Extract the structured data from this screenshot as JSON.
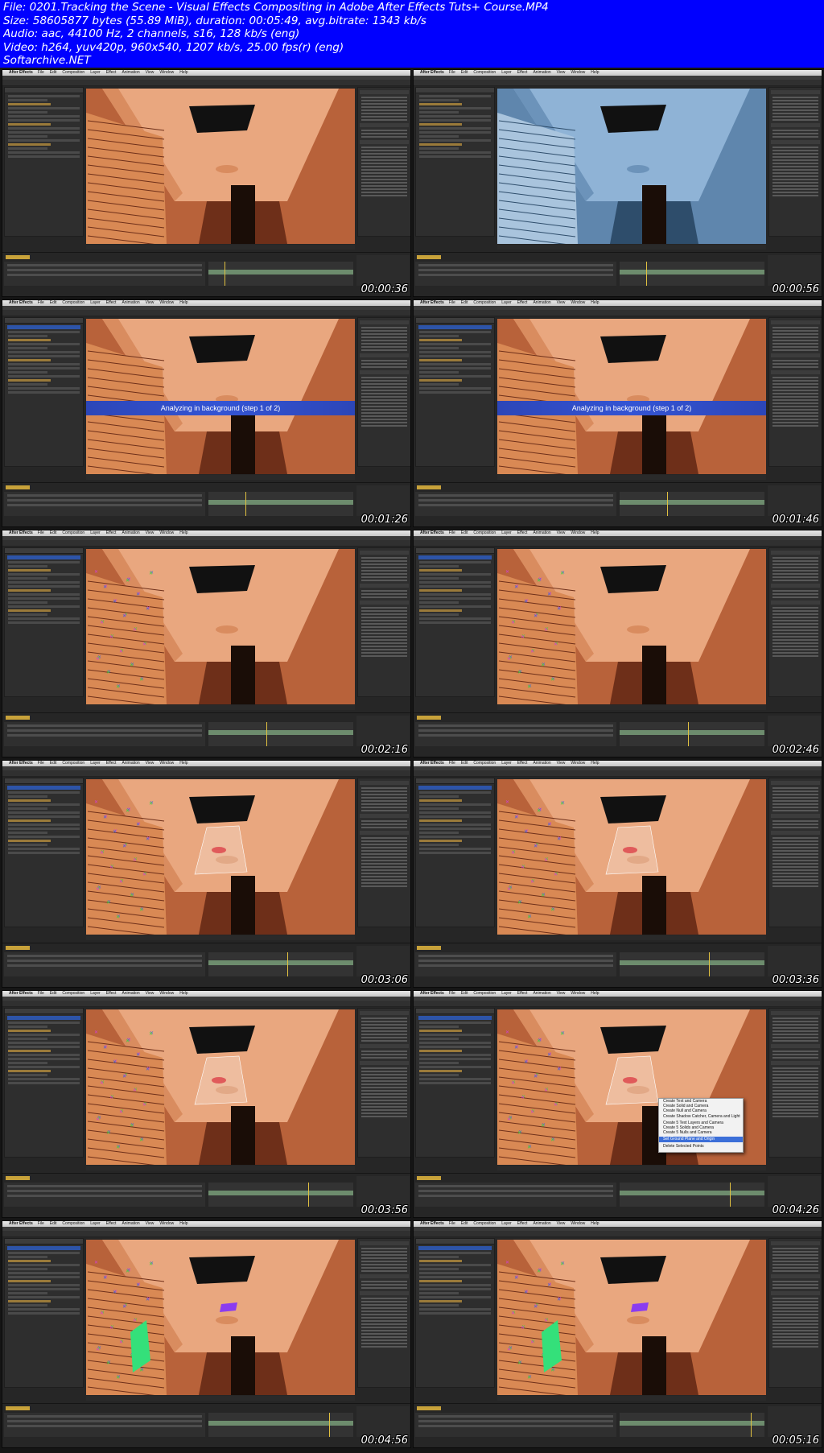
{
  "header": {
    "lines": [
      "File: 0201.Tracking the Scene - Visual Effects Compositing in Adobe After Effects Tuts+ Course.MP4",
      "Size: 58605877 bytes (55.89 MiB), duration: 00:05:49, avg.bitrate: 1343 kb/s",
      "Audio: aac, 44100 Hz, 2 channels, s16, 128 kb/s (eng)",
      "Video: h264, yuv420p, 960x540, 1207 kb/s, 25.00 fps(r) (eng)",
      "Softarchive.NET"
    ]
  },
  "menubar": {
    "app": "After Effects",
    "items": [
      "File",
      "Edit",
      "Composition",
      "Layer",
      "Effect",
      "Animation",
      "View",
      "Window",
      "Help"
    ]
  },
  "thumbnails": [
    {
      "time": "00:00:36",
      "variant": "orange"
    },
    {
      "time": "00:00:56",
      "variant": "blue"
    },
    {
      "time": "00:01:26",
      "variant": "banner"
    },
    {
      "time": "00:01:46",
      "variant": "banner"
    },
    {
      "time": "00:02:16",
      "variant": "track"
    },
    {
      "time": "00:02:46",
      "variant": "track"
    },
    {
      "time": "00:03:06",
      "variant": "target"
    },
    {
      "time": "00:03:36",
      "variant": "target"
    },
    {
      "time": "00:03:56",
      "variant": "target"
    },
    {
      "time": "00:04:26",
      "variant": "menu"
    },
    {
      "time": "00:04:56",
      "variant": "solids"
    },
    {
      "time": "00:05:16",
      "variant": "solids"
    }
  ],
  "banner_text": "Analyzing in background (step 1 of 2)",
  "context_menu": [
    "Create Text and Camera",
    "Create Solid and Camera",
    "Create Null and Camera",
    "Create Shadow Catcher, Camera and Light",
    "",
    "Create 5 Text Layers and Camera",
    "Create 5 Solids and Camera",
    "Create 5 Nulls and Camera",
    "",
    "Set Ground Plane and Origin",
    "",
    "Delete Selected Points"
  ],
  "colors": {
    "header_bg": "#0000ff",
    "banner": "#3454d4",
    "timecode": "#c8a23a",
    "track_points": [
      "#d040d0",
      "#40d040",
      "#4060e0"
    ],
    "solid_green": "#34e07a",
    "solid_purple": "#8a3cf0"
  }
}
